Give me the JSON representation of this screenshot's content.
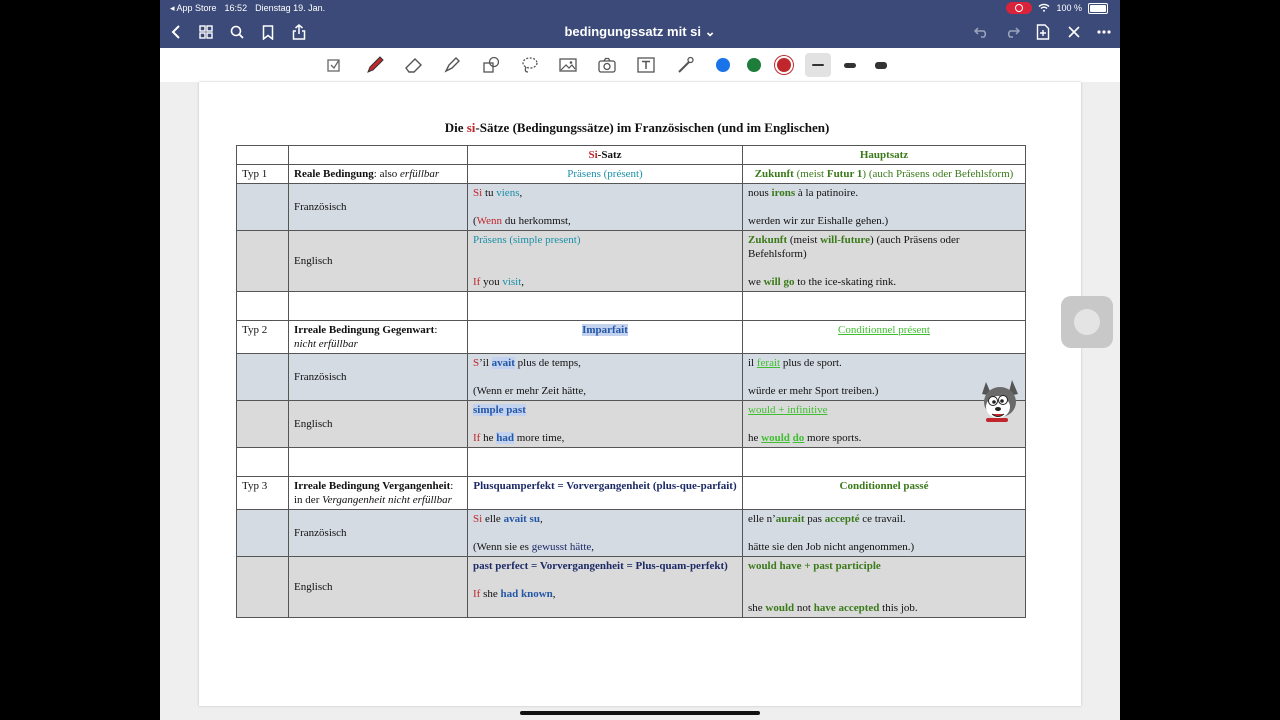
{
  "status": {
    "back_app": "◂ App Store",
    "time": "16:52",
    "date": "Dienstag 19. Jan.",
    "battery": "100 %"
  },
  "nav": {
    "title": "bedingungssatz mit si ⌄"
  },
  "toolbar": {
    "colors": [
      "#1a73e8",
      "#1e7d3a",
      "#c0272d"
    ]
  },
  "document": {
    "heading_pre": "Die ",
    "heading_si": "si",
    "heading_post": "-Sätze (Bedingungssätze) im Französischen (und im Englischen)",
    "col_si_a": "Si",
    "col_si_b": "-Satz",
    "col_haupt": "Hauptsatz",
    "t1": {
      "type": "Typ 1",
      "cond_b": "Reale Bedingung",
      "cond_rest": ": also ",
      "cond_i": "erfüllbar",
      "si_head": "Präsens (présent)",
      "main_head_b": "Zukunft",
      "main_head_mid": " (meist ",
      "main_head_b2": "Futur 1",
      "main_head_end": ") (auch Präsens oder Befehlsform)",
      "fr_label": "Französisch",
      "fr_si_a": "Si",
      "fr_si_b": " tu ",
      "fr_si_c": "viens",
      "fr_si_d": ",",
      "fr_si2_a": "(",
      "fr_si2_b": "Wenn",
      "fr_si2_c": " du herkommst,",
      "fr_main_a": "nous ",
      "fr_main_b": "irons",
      "fr_main_c": " à la patinoire.",
      "fr_main2": "werden wir zur Eishalle gehen.)",
      "en_label": "Englisch",
      "en_si_head": "Präsens (simple present)",
      "en_si_a": "If",
      "en_si_b": " you ",
      "en_si_c": "visit",
      "en_si_d": ",",
      "en_main_b": "Zukunft",
      "en_main_mid": " (meist ",
      "en_main_b2": "will-future",
      "en_main_end": ") (auch Präsens oder Befehlsform)",
      "en_main2_a": "we ",
      "en_main2_b": "will go",
      "en_main2_c": " to the ice-skating rink."
    },
    "t2": {
      "type": "Typ 2",
      "cond_b": "Irreale Bedingung Gegenwart",
      "cond_rest": ":",
      "cond_i": "nicht erfüllbar",
      "si_head": "Imparfait",
      "main_head": "Conditionnel présent",
      "fr_label": "Französisch",
      "fr_si_a": "S",
      "fr_si_b": "’il ",
      "fr_si_c": "avait",
      "fr_si_d": " plus de temps,",
      "fr_si2": "(Wenn er mehr Zeit hätte,",
      "fr_main_a": "il ",
      "fr_main_b": "ferait",
      "fr_main_c": " plus de sport.",
      "fr_main2": "würde er mehr Sport treiben.)",
      "en_label": "Englisch",
      "en_si_head": "simple past",
      "en_si_a": "If",
      "en_si_b": " he ",
      "en_si_c": "had",
      "en_si_d": " more time,",
      "en_main_head": "would + infinitive",
      "en_main_a": "he ",
      "en_main_b": "would",
      "en_main_c": " ",
      "en_main_d": "do",
      "en_main_e": " more sports."
    },
    "t3": {
      "type": "Typ 3",
      "cond_b": "Irreale Bedingung Vergangenheit",
      "cond_rest": ": in der ",
      "cond_i": "Vergangenheit nicht erfüllbar",
      "si_head": "Plusquamperfekt = Vorvergangenheit (plus-que-parfait)",
      "main_head": "Conditionnel passé",
      "fr_label": "Französisch",
      "fr_si_a": "Si",
      "fr_si_b": " elle ",
      "fr_si_c": "avait su",
      "fr_si_d": ",",
      "fr_si2_a": "(Wenn sie es ",
      "fr_si2_b": "gewusst hätte",
      "fr_si2_c": ",",
      "fr_main_a": "elle n’",
      "fr_main_b": "aurait",
      "fr_main_c": " pas ",
      "fr_main_d": "accepté",
      "fr_main_e": " ce travail.",
      "fr_main2": "hätte sie den Job nicht angenommen.)",
      "en_label": "Englisch",
      "en_si_head": "past perfect = Vorvergangenheit = Plus-quam-perfekt)",
      "en_si_a": "If",
      "en_si_b": " she ",
      "en_si_c": "had known",
      "en_si_d": ",",
      "en_main_head": "would have + past participle",
      "en_main_a": "she ",
      "en_main_b": "would",
      "en_main_c": " not ",
      "en_main_d": "have accepted",
      "en_main_e": " this job."
    }
  }
}
